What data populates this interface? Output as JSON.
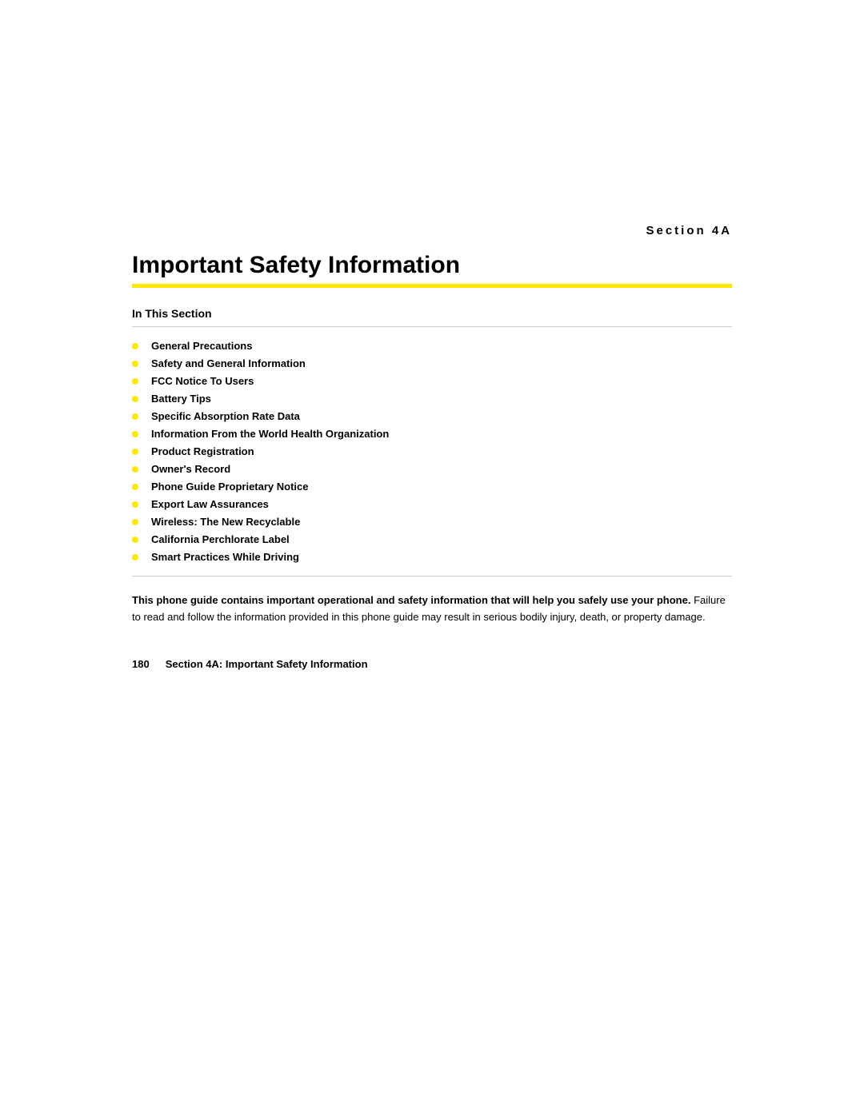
{
  "section": {
    "label": "Section 4A",
    "title": "Important Safety Information",
    "accent_color": "#FFE800"
  },
  "in_this_section": {
    "heading": "In This Section",
    "items": [
      {
        "text": "General Precautions"
      },
      {
        "text": "Safety and General Information"
      },
      {
        "text": "FCC Notice To Users"
      },
      {
        "text": "Battery Tips"
      },
      {
        "text": "Specific Absorption Rate Data"
      },
      {
        "text": "Information From the World Health Organization"
      },
      {
        "text": "Product Registration"
      },
      {
        "text": "Owner's Record"
      },
      {
        "text": "Phone Guide Proprietary Notice"
      },
      {
        "text": "Export Law Assurances"
      },
      {
        "text": "Wireless: The New Recyclable"
      },
      {
        "text": "California Perchlorate Label"
      },
      {
        "text": "Smart Practices While Driving"
      }
    ]
  },
  "description": {
    "bold_part": "This phone guide contains important operational and safety information that will help you safely use your phone.",
    "normal_part": " Failure to read and follow the information provided in this phone guide may result in serious bodily injury, death, or property damage."
  },
  "footer": {
    "page_number": "180",
    "section_label": "Section 4A: Important Safety Information"
  }
}
